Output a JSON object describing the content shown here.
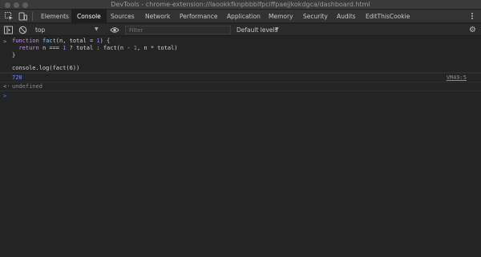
{
  "window": {
    "title": "DevTools - chrome-extension://laookkfknpbbblfpciffpaejjkokdgca/dashboard.html"
  },
  "tabs": [
    {
      "label": "Elements",
      "active": false
    },
    {
      "label": "Console",
      "active": true
    },
    {
      "label": "Sources",
      "active": false
    },
    {
      "label": "Network",
      "active": false
    },
    {
      "label": "Performance",
      "active": false
    },
    {
      "label": "Application",
      "active": false
    },
    {
      "label": "Memory",
      "active": false
    },
    {
      "label": "Security",
      "active": false
    },
    {
      "label": "Audits",
      "active": false
    },
    {
      "label": "EditThisCookie",
      "active": false
    }
  ],
  "toolbar": {
    "context": "top",
    "filter_placeholder": "Filter",
    "levels": "Default levels"
  },
  "console": {
    "input_1": [
      "function fact(n, total = 1) {",
      "  return n === 1 ? total : fact(n - 1, n * total)",
      "}",
      "",
      "console.log(fact(6))"
    ],
    "log_value": "720",
    "log_source": "VM49:5",
    "return_value": "undefined"
  },
  "colors": {
    "background": "#242424",
    "active_tab": "#1f1f1f",
    "accent": "#4a8af4"
  }
}
